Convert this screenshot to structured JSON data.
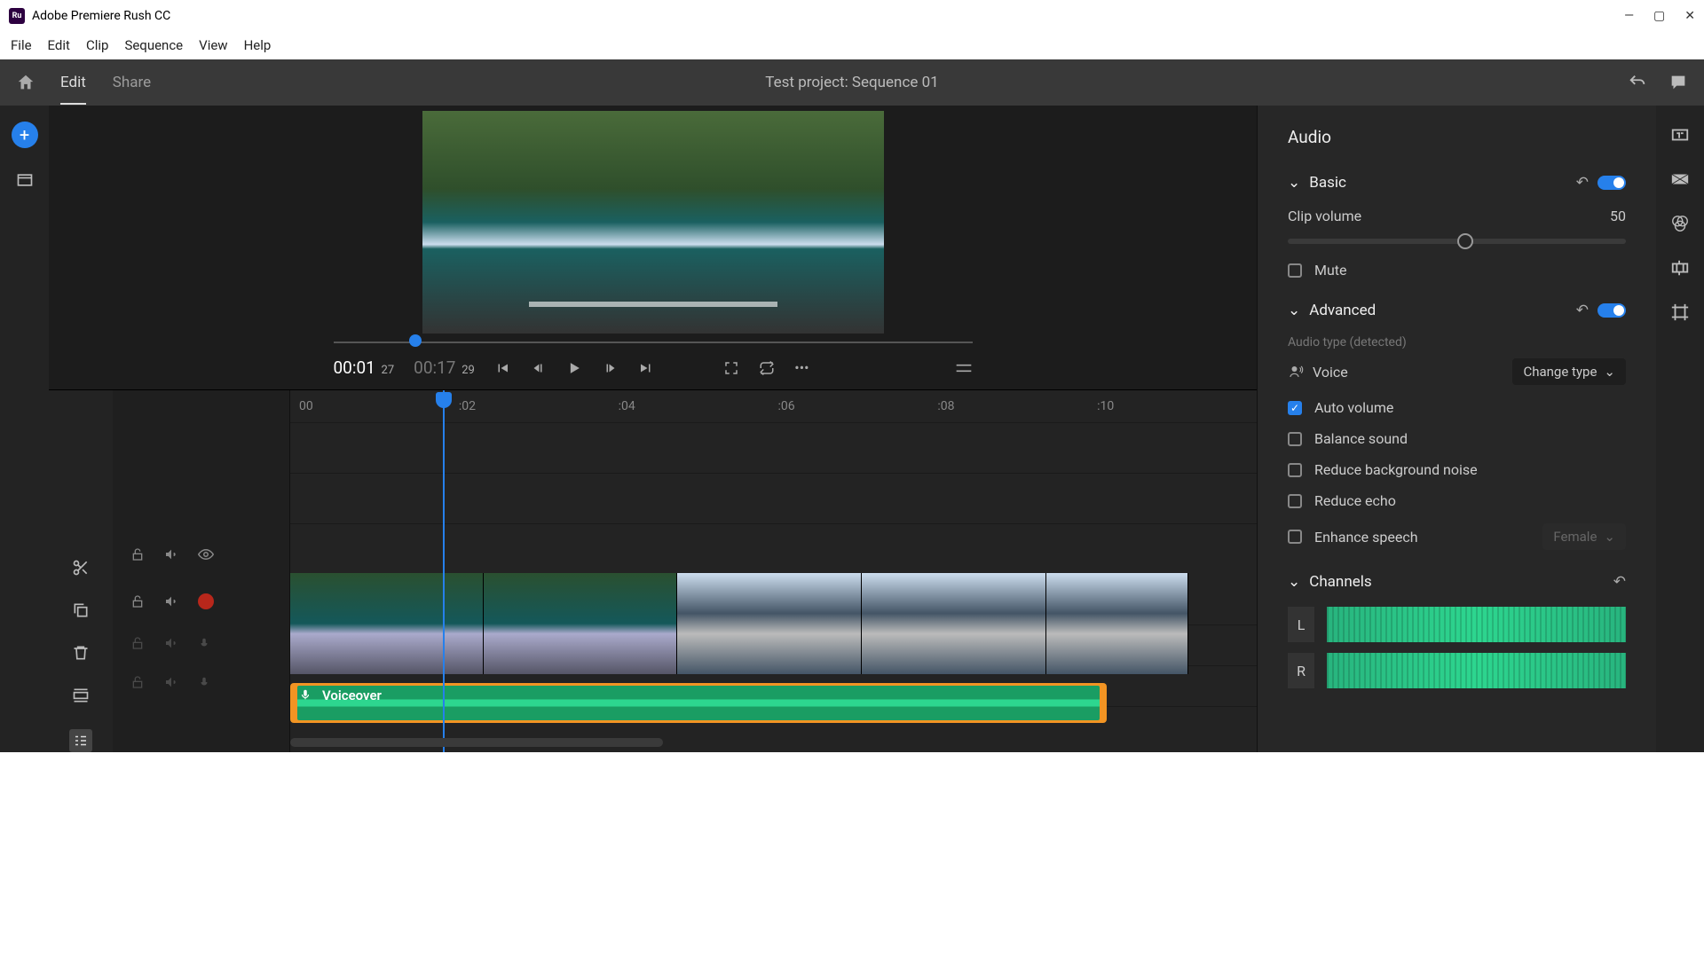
{
  "window": {
    "title": "Adobe Premiere Rush CC",
    "app_icon_text": "Ru"
  },
  "menus": [
    "File",
    "Edit",
    "Clip",
    "Sequence",
    "View",
    "Help"
  ],
  "appbar": {
    "tabs": [
      "Edit",
      "Share"
    ],
    "project_title": "Test project: Sequence 01"
  },
  "transport": {
    "current": "00:01",
    "current_frame": "27",
    "total": "00:17",
    "total_frame": "29"
  },
  "ruler": [
    "00",
    ":02",
    ":04",
    ":06",
    ":08",
    ":10"
  ],
  "tracks": {
    "voiceover_label": "Voiceover"
  },
  "audio_panel": {
    "title": "Audio",
    "basic": {
      "label": "Basic",
      "clip_volume_label": "Clip volume",
      "clip_volume_value": "50",
      "mute_label": "Mute"
    },
    "advanced": {
      "label": "Advanced",
      "audio_type_hint": "Audio type (detected)",
      "voice_label": "Voice",
      "change_type_label": "Change type",
      "auto_volume": "Auto volume",
      "balance_sound": "Balance sound",
      "reduce_bg": "Reduce background noise",
      "reduce_echo": "Reduce echo",
      "enhance_speech": "Enhance speech",
      "enhance_speech_option": "Female"
    },
    "channels": {
      "label": "Channels",
      "left": "L",
      "right": "R"
    }
  }
}
